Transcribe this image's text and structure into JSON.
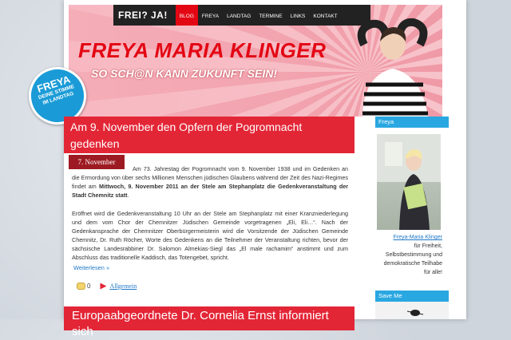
{
  "header": {
    "logo": "FREI? JA!",
    "nav": [
      "BLOG",
      "FREYA",
      "LANDTAG",
      "TERMINE",
      "LINKS",
      "KONTAKT"
    ],
    "title": "FREYA MARIA KLINGER",
    "subtitle": "SO SCH@N KANN ZUKUNFT SEIN!"
  },
  "badge": {
    "name": "FREYA",
    "line1": "DEINE STIMME",
    "line2": "IM LANDTAG"
  },
  "article": {
    "title_line1": "Am 9. November den Opfern der Pogromnacht",
    "title_line2": "gedenken",
    "date": "7. November",
    "p1_a": "Am 73. Jahrestag der Pogromnacht vom 9. November 1938 und im Gedenken an die Ermordung von über sechs Millionen Menschen jüdischen Glaubens während der Zeit des Nazi-Regimes findet am ",
    "p1_b": "Mittwoch, 9. November 2011 an der Stele am Stephanplatz die Gedenkveranstaltung der Stadt Chemnitz statt",
    "p1_c": ".",
    "p2": "Eröffnet wird die Gedenkveranstaltung 10 Uhr an der Stele am Stephanplatz mit einer Kranzniederlegung und dem vom Chor der Chemnitzer Jüdischen Gemeinde vorgetragenen „Eli, Eli…“. Nach der Gedenkansprache der Chemnitzer Oberbürgermeisterin wird die Vorsitzende der Jüdischen Gemeinde Chemnitz, Dr. Ruth Röcher, Worte des Gedenkens an die Teilnehmer der Veranstaltung richten, bevor der sächsische Landesrabbiner Dr. Salomon Almekias-Siegl das „El male rachamim“ anstimmt und zum Abschluss das traditionelle Kaddisch, das Totengebet, spricht.",
    "read_more": "Weiterlesen »",
    "comment_count": "0",
    "category": "Allgemein"
  },
  "article2": {
    "title": "Europaabgeordnete Dr. Cornelia Ernst informiert sich"
  },
  "sidebar": {
    "freya_heading": "Freya",
    "name_link": "Freya-Maria Klinger",
    "caption_lines": [
      "für Freiheit,",
      "Selbstbestimmung und",
      "demokratische Teilhabe",
      "für alle!"
    ],
    "saveme_heading": "Save Me"
  },
  "colors": {
    "accent_red": "#e32636",
    "dark_red": "#9e1a22",
    "blue": "#29a7e1",
    "link": "#1f78c8"
  }
}
